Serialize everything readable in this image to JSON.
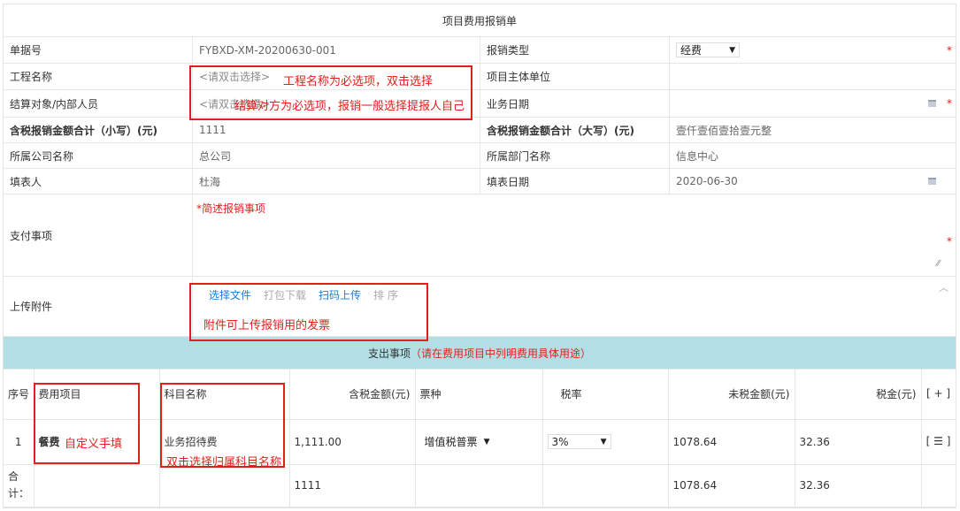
{
  "form_title": "项目费用报销单",
  "fields": {
    "doc_no_label": "单据号",
    "doc_no_value": "FYBXD-XM-20200630-001",
    "reimb_type_label": "报销类型",
    "reimb_type_value": "经费",
    "project_name_label": "工程名称",
    "project_name_placeholder": "<请双击选择>",
    "project_owner_label": "项目主体单位",
    "settle_label": "结算对象/内部人员",
    "settle_placeholder": "<请双击选择>",
    "biz_date_label": "业务日期",
    "amount_small_label": "含税报销金额合计（小写）(元)",
    "amount_small_value": "1111",
    "amount_big_label": "含税报销金额合计（大写）(元)",
    "amount_big_value": "壹仟壹佰壹拾壹元整",
    "company_label": "所属公司名称",
    "company_value": "总公司",
    "dept_label": "所属部门名称",
    "dept_value": "信息中心",
    "filler_label": "填表人",
    "filler_value": "杜海",
    "fill_date_label": "填表日期",
    "fill_date_value": "2020-06-30",
    "payment_label": "支付事项",
    "payment_hint": "*简述报销事项",
    "upload_label": "上传附件",
    "required_mark": "*"
  },
  "upload_actions": {
    "choose_file": "选择文件",
    "pack_download": "打包下载",
    "scan_upload": "扫码上传",
    "sort": "排 序"
  },
  "expense": {
    "band_label": "支出事项",
    "band_hint": "（请在费用项目中列明费用具体用途）",
    "headers": {
      "seq": "序号",
      "item": "费用项目",
      "subject": "科目名称",
      "amount_tax": "含税金额(元)",
      "ticket": "票种",
      "rate": "税率",
      "amount_notax": "未税金额(元)",
      "tax": "税金(元)",
      "add": "[ + ]"
    },
    "row": {
      "seq": "1",
      "item": "餐费",
      "subject": "业务招待费",
      "amount_tax": "1,111.00",
      "ticket": "增值税普票",
      "rate": "3%",
      "amount_notax": "1078.64",
      "tax": "32.36",
      "menu": "[ ☰ ]"
    },
    "total": {
      "label": "合计：",
      "amount_tax": "1111",
      "amount_notax": "1078.64",
      "tax": "32.36"
    }
  },
  "annotations": {
    "project_name": "工程名称为必选项，双击选择",
    "settle": "结算对方为必选项，报销一般选择提报人自己",
    "upload": "附件可上传报销用的发票",
    "item": "自定义手填",
    "subject": "双击选择归属科目名称"
  }
}
